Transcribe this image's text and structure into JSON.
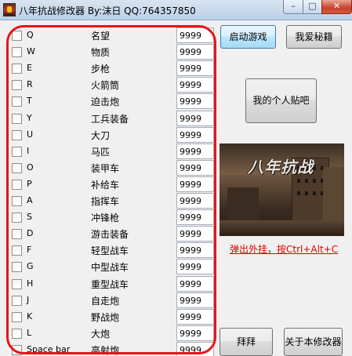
{
  "window": {
    "title": "八年抗战修改器 By:沫日 QQ:764357850",
    "minimize_glyph": "–",
    "maximize_glyph": "□",
    "close_glyph": "✕"
  },
  "items": [
    {
      "key": "Q",
      "label": "名望",
      "value": "9999"
    },
    {
      "key": "W",
      "label": "物质",
      "value": "9999"
    },
    {
      "key": "E",
      "label": "步枪",
      "value": "9999"
    },
    {
      "key": "R",
      "label": "火箭筒",
      "value": "9999"
    },
    {
      "key": "T",
      "label": "迫击炮",
      "value": "9999"
    },
    {
      "key": "Y",
      "label": "工兵装备",
      "value": "9999"
    },
    {
      "key": "U",
      "label": "大刀",
      "value": "9999"
    },
    {
      "key": "I",
      "label": "马匹",
      "value": "9999"
    },
    {
      "key": "O",
      "label": "装甲车",
      "value": "9999"
    },
    {
      "key": "P",
      "label": "补给车",
      "value": "9999"
    },
    {
      "key": "A",
      "label": "指挥车",
      "value": "9999"
    },
    {
      "key": "S",
      "label": "冲锋枪",
      "value": "9999"
    },
    {
      "key": "D",
      "label": "游击装备",
      "value": "9999"
    },
    {
      "key": "F",
      "label": "轻型战车",
      "value": "9999"
    },
    {
      "key": "G",
      "label": "中型战车",
      "value": "9999"
    },
    {
      "key": "H",
      "label": "重型战车",
      "value": "9999"
    },
    {
      "key": "J",
      "label": "自走炮",
      "value": "9999"
    },
    {
      "key": "K",
      "label": "野战炮",
      "value": "9999"
    },
    {
      "key": "L",
      "label": "大炮",
      "value": "9999"
    },
    {
      "key": "Space bar",
      "label": "高射炮",
      "value": "9999"
    }
  ],
  "buttons": {
    "start_game": "启动游戏",
    "my_cheats": "我爱秘籍",
    "my_post": "我的个人贴吧",
    "bye": "拜拜",
    "about": "关于本修改器"
  },
  "banner": {
    "title": "八年抗战"
  },
  "hotkey_link": "弹出外挂，按Ctrl+Alt+C",
  "colors": {
    "outline_red": "#e8141a",
    "link_red": "#e00000",
    "focus_blue": "#3c7fb1"
  }
}
